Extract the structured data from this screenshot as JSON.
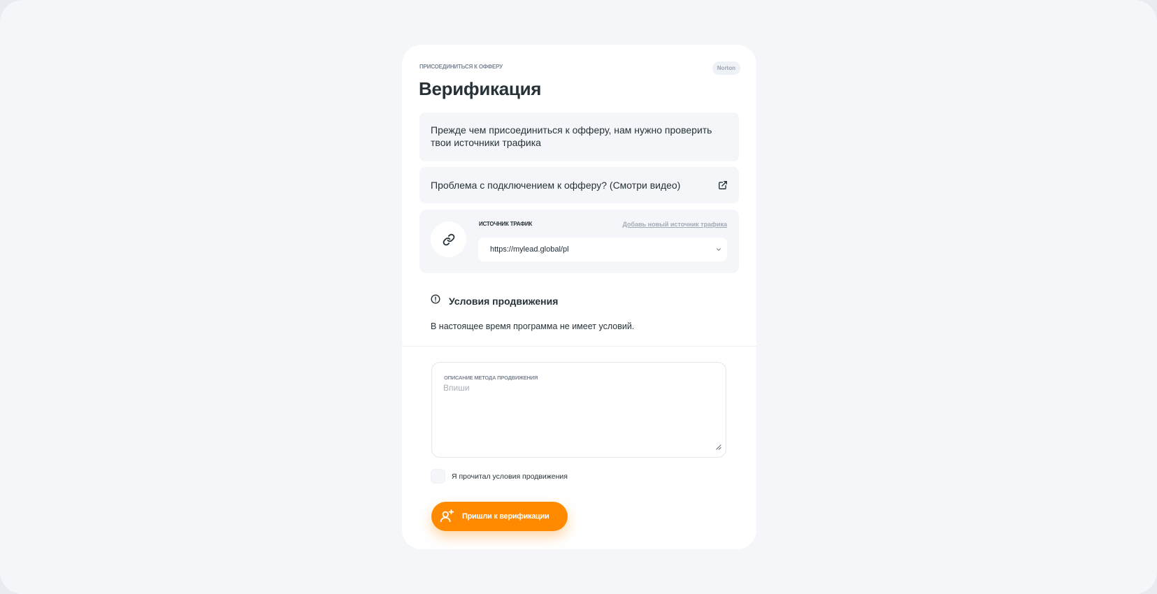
{
  "modal": {
    "eyebrow": "ПРИСОЕДИНИТЬСЯ К ОФФЕРУ",
    "brand_badge": "Norton",
    "title": "Верификация",
    "info_text": "Прежде чем присоединиться к офферу, нам нужно проверить твои источники трафика",
    "problem_text": "Проблема с подключением к офферу? (Смотри видео)",
    "problem_icon": "external-link-icon"
  },
  "traffic_source": {
    "label": "ИСТОЧНИК ТРАФИК",
    "add_link": "Добавь новый источник трафика",
    "selected_value": "https://mylead.global/pl",
    "icon": "link-icon"
  },
  "conditions": {
    "title": "Условия продвижения",
    "text": "В настоящее время программа не имеет условий.",
    "icon": "alert-circle-icon"
  },
  "promotion_description": {
    "label": "ОПИСАНИЕ МЕТОДА ПРОДВИЖЕНИЯ",
    "placeholder": "Впиши",
    "value": ""
  },
  "agreement": {
    "label": "Я прочитал условия продвижения",
    "checked": false
  },
  "submit": {
    "label": "Пришли к верификации",
    "icon": "user-plus-icon"
  },
  "colors": {
    "accent": "#ff8a00",
    "panel_bg": "#f4f6f9",
    "text_primary": "#263238",
    "text_muted": "#a3abb7"
  }
}
